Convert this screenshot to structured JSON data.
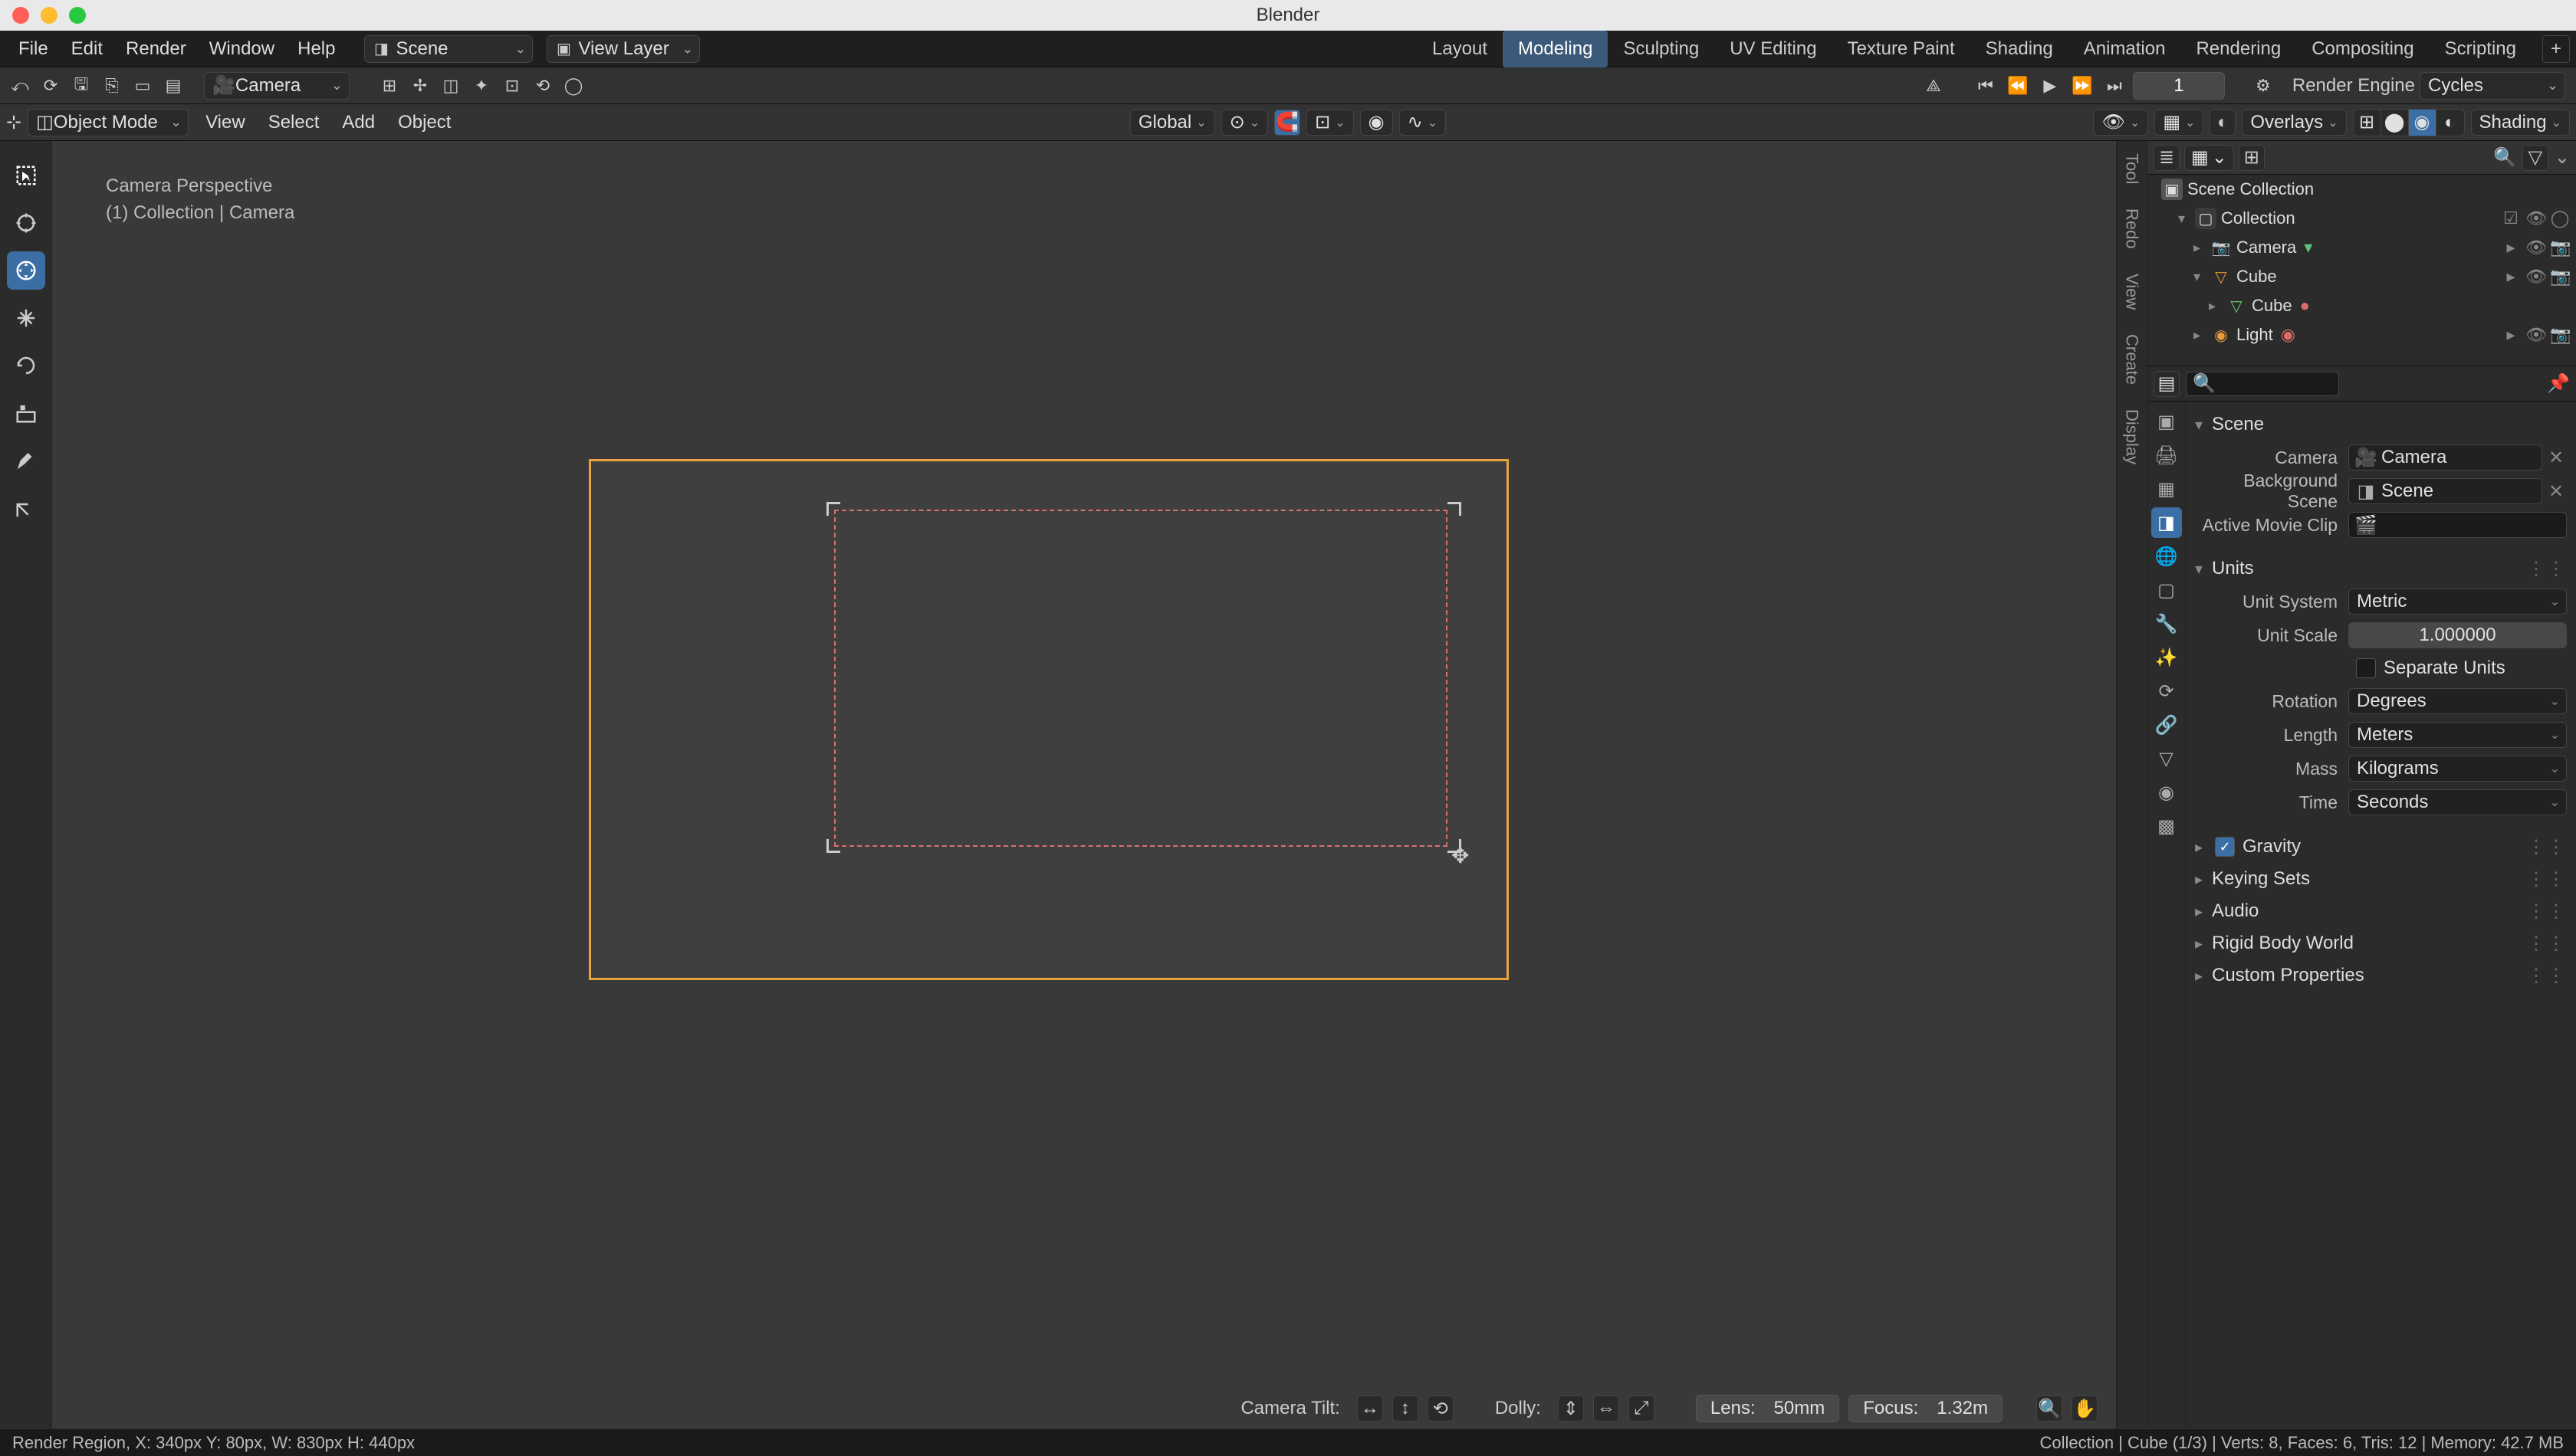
{
  "titlebar": {
    "title": "Blender"
  },
  "menubar": {
    "items": [
      "File",
      "Edit",
      "Render",
      "Window",
      "Help"
    ],
    "scene_label": "Scene",
    "viewlayer_label": "View Layer",
    "tabs": [
      "Layout",
      "Modeling",
      "Sculpting",
      "UV Editing",
      "Texture Paint",
      "Shading",
      "Animation",
      "Rendering",
      "Compositing",
      "Scripting"
    ],
    "active_tab": "Modeling"
  },
  "toolbar2": {
    "camera_label": "Camera",
    "frame": "1",
    "render_engine_label": "Render Engine",
    "render_engine_value": "Cycles"
  },
  "viewhdr": {
    "mode": "Object Mode",
    "menus": [
      "View",
      "Select",
      "Add",
      "Object"
    ],
    "orientation": "Global",
    "overlays_label": "Overlays",
    "shading_label": "Shading"
  },
  "viewport": {
    "title": "Camera Perspective",
    "subtitle": "(1) Collection | Camera",
    "footer": {
      "tilt_label": "Camera Tilt:",
      "dolly_label": "Dolly:",
      "lens_label": "Lens:",
      "lens_value": "50mm",
      "focus_label": "Focus:",
      "focus_value": "1.32m"
    }
  },
  "vtabs": [
    "Tool",
    "Redo",
    "View",
    "Create",
    "Display"
  ],
  "outliner": {
    "scene_collection": "Scene Collection",
    "collection": "Collection",
    "camera": "Camera",
    "cube": "Cube",
    "cube_data": "Cube",
    "light": "Light"
  },
  "search_placeholder": "",
  "scene_panel": {
    "header": "Scene",
    "camera_label": "Camera",
    "camera_value": "Camera",
    "bg_scene_label": "Background Scene",
    "bg_scene_value": "Scene",
    "clip_label": "Active Movie Clip"
  },
  "units_panel": {
    "header": "Units",
    "system_label": "Unit System",
    "system_value": "Metric",
    "scale_label": "Unit Scale",
    "scale_value": "1.000000",
    "separate_label": "Separate Units",
    "rotation_label": "Rotation",
    "rotation_value": "Degrees",
    "length_label": "Length",
    "length_value": "Meters",
    "mass_label": "Mass",
    "mass_value": "Kilograms",
    "time_label": "Time",
    "time_value": "Seconds"
  },
  "collapsed_panels": {
    "gravity": "Gravity",
    "keying": "Keying Sets",
    "audio": "Audio",
    "rigid": "Rigid Body World",
    "custom": "Custom Properties"
  },
  "statusbar": {
    "left": "Render Region, X: 340px Y: 80px, W: 830px H: 440px",
    "right": "Collection | Cube (1/3) | Verts: 8, Faces: 6, Tris: 12 | Memory: 42.7 MB"
  }
}
